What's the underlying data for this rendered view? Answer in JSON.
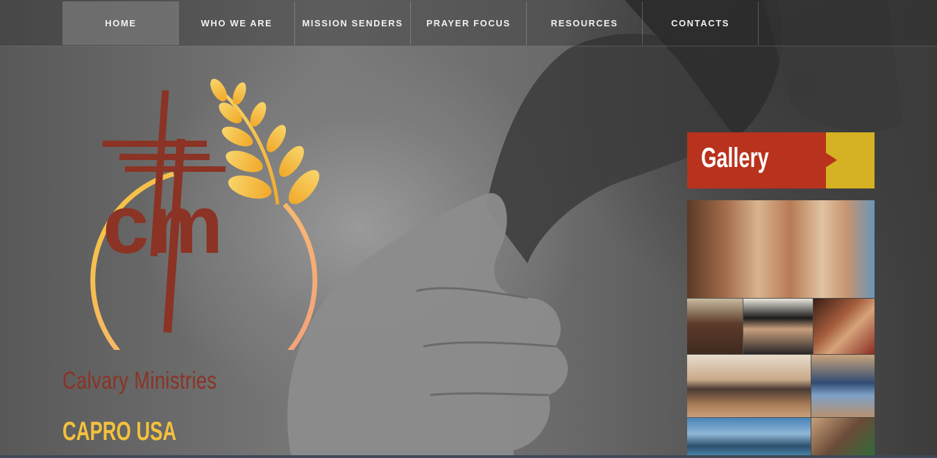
{
  "nav": {
    "items": [
      {
        "label": "HOME",
        "active": true
      },
      {
        "label": "WHO WE ARE",
        "active": false
      },
      {
        "label": "MISSION SENDERS",
        "active": false
      },
      {
        "label": "PRAYER FOCUS",
        "active": false
      },
      {
        "label": "RESOURCES",
        "active": false
      },
      {
        "label": "CONTACTS",
        "active": false
      }
    ]
  },
  "brand": {
    "logo_letters": "cm",
    "name": "Calvary Ministries",
    "subtitle": "CAPRO USA"
  },
  "gallery": {
    "title": "Gallery"
  },
  "colors": {
    "brand_red": "#8b3324",
    "brand_gold": "#f3c13c",
    "gallery_red": "#b8321d",
    "gallery_yellow": "#d4b223"
  }
}
